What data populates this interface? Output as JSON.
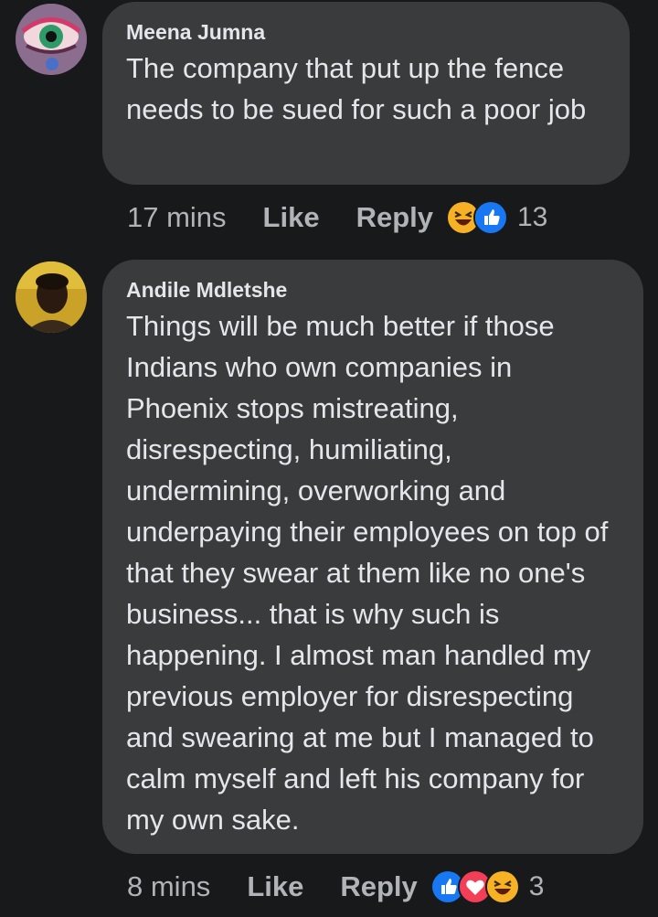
{
  "comments": [
    {
      "author": "Meena Jumna",
      "text": "The company that put up the fence needs to be sued for such a poor job",
      "time": "17 mins",
      "like_label": "Like",
      "reply_label": "Reply",
      "reactions": [
        "haha",
        "like"
      ],
      "reaction_count": "13"
    },
    {
      "author": "Andile Mdletshe",
      "text": "Things will be much better if those Indians who own companies in Phoenix stops mistreating, disrespecting, humiliating, undermining, overworking and underpaying their employees on top of that they swear at them like no one's business... that is why such is happening. I almost man handled my previous employer for disrespecting and swearing at me but I managed to calm myself and left his company for my own sake.",
      "time": "8 mins",
      "like_label": "Like",
      "reply_label": "Reply",
      "reactions": [
        "like",
        "love",
        "haha"
      ],
      "reaction_count": "3"
    }
  ],
  "colors": {
    "background": "#18191a",
    "bubble": "#3a3b3c",
    "primary_text": "#e4e6eb",
    "secondary_text": "#b0b3b8",
    "like_blue": "#1877f2",
    "love_red": "#f33e58",
    "haha_yellow": "#f7b125"
  }
}
